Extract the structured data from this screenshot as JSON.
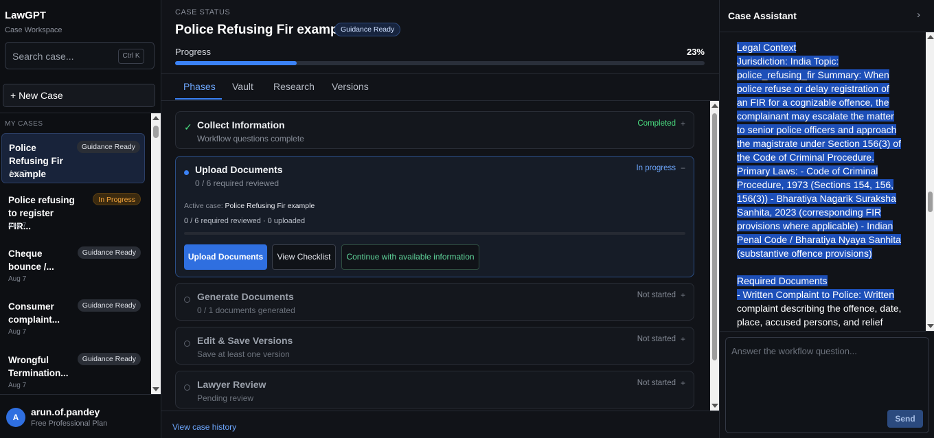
{
  "sidebar": {
    "brand": "LawGPT",
    "brand_sub": "Case Workspace",
    "search_placeholder": "Search case...",
    "search_shortcut": "Ctrl K",
    "new_case_label": "+ New Case",
    "section_label": "MY CASES",
    "cases": [
      {
        "title": "Police Refusing Fir example",
        "badge": "Guidance Ready",
        "date": "Aug 7"
      },
      {
        "title": "Police refusing to register FIR...",
        "badge": "In Progress",
        "date": "Aug 7"
      },
      {
        "title": "Cheque bounce /...",
        "badge": "Guidance Ready",
        "date": "Aug 7"
      },
      {
        "title": "Consumer complaint...",
        "badge": "Guidance Ready",
        "date": "Aug 7"
      },
      {
        "title": "Wrongful Termination...",
        "badge": "Guidance Ready",
        "date": "Aug 7"
      }
    ],
    "user": {
      "initial": "A",
      "name": "arun.of.pandey",
      "plan": "Free Professional Plan"
    }
  },
  "main": {
    "case_status_label": "CASE STATUS",
    "title": "Police Refusing Fir example",
    "title_badge": "Guidance Ready",
    "progress_label": "Progress",
    "progress_pct": "23%",
    "progress_value": 23,
    "tabs": [
      "Phases",
      "Vault",
      "Research",
      "Versions"
    ],
    "phases": [
      {
        "title": "Collect Information",
        "sub": "Workflow questions complete",
        "status": "Completed",
        "toggle": "+"
      },
      {
        "title": "Upload Documents",
        "sub": "0 / 6 required reviewed",
        "status": "In progress",
        "toggle": "−",
        "active_case_label": "Active case:",
        "active_case_value": "Police Refusing Fir example",
        "req_line": "0 / 6 required reviewed · 0 uploaded",
        "btn_upload": "Upload Documents",
        "btn_checklist": "View Checklist",
        "btn_continue": "Continue with available information"
      },
      {
        "title": "Generate Documents",
        "sub": "0 / 1 documents generated",
        "status": "Not started",
        "toggle": "+"
      },
      {
        "title": "Edit & Save Versions",
        "sub": "Save at least one version",
        "status": "Not started",
        "toggle": "+"
      },
      {
        "title": "Lawyer Review",
        "sub": "Pending review",
        "status": "Not started",
        "toggle": "+"
      }
    ],
    "history_link": "View case history"
  },
  "assistant": {
    "title": "Case Assistant",
    "lines": [
      "Legal Context",
      "Jurisdiction: India Topic:",
      "police_refusing_fir Summary: When",
      "police refuse or delay registration of",
      "an FIR for a cognizable offence, the",
      "complainant may escalate the matter",
      "to senior police officers and approach",
      "the magistrate under Section 156(3) of",
      "the Code of Criminal Procedure.",
      "Primary Laws: - Code of Criminal",
      "Procedure, 1973 (Sections 154, 156,",
      "156(3)) - Bharatiya Nagarik Suraksha",
      "Sanhita, 2023 (corresponding FIR",
      "provisions where applicable) - Indian",
      "Penal Code / Bharatiya Nyaya Sanhita",
      "(substantive offence provisions)",
      "",
      "Required Documents",
      "- Written Complaint to Police: Written",
      "complaint describing the offence, date,",
      "place, accused persons, and relief"
    ],
    "answer_placeholder": "Answer the workflow question...",
    "send_label": "Send"
  },
  "colors": {
    "accent": "#3b82f6",
    "completed": "#4ade80",
    "in_progress": "#6ea8ff",
    "not_started": "#858b96",
    "warning": "#f3a33a"
  }
}
